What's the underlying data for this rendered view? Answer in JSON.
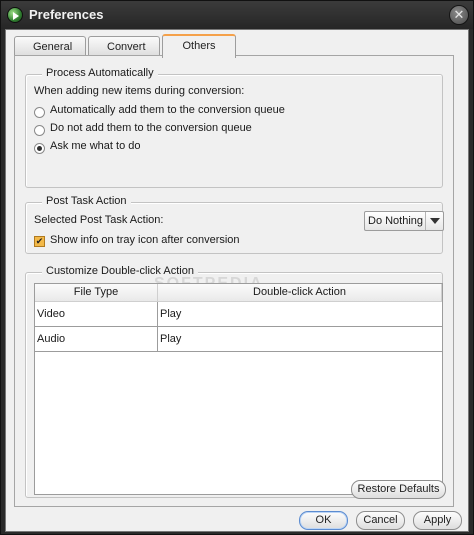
{
  "window": {
    "title": "Preferences",
    "close_glyph": "✕"
  },
  "tabs": [
    {
      "label": "General",
      "active": false
    },
    {
      "label": "Convert",
      "active": false
    },
    {
      "label": "Others",
      "active": true
    }
  ],
  "process_automatically": {
    "title": "Process Automatically",
    "prompt": "When adding new items during conversion:",
    "options": [
      {
        "label": "Automatically add them to the conversion queue",
        "selected": false
      },
      {
        "label": "Do not add them to the conversion queue",
        "selected": false
      },
      {
        "label": "Ask me what to do",
        "selected": true
      }
    ]
  },
  "post_task": {
    "title": "Post Task Action",
    "label": "Selected Post Task Action:",
    "dropdown_value": "Do Nothing",
    "checkbox_label": "Show info on tray icon after conversion",
    "checkbox_checked": true
  },
  "double_click": {
    "title": "Customize Double-click Action",
    "columns": [
      "File Type",
      "Double-click Action"
    ],
    "rows": [
      {
        "file_type": "Video",
        "action": "Play"
      },
      {
        "file_type": "Audio",
        "action": "Play"
      }
    ]
  },
  "buttons": {
    "restore_defaults": "Restore Defaults",
    "ok": "OK",
    "cancel": "Cancel",
    "apply": "Apply"
  },
  "watermark": "SOFTPEDIA",
  "colors": {
    "title_bar": "#2a2a2a",
    "active_tab_accent": "#f5a14a",
    "checkbox_fill": "#f3b948",
    "primary_button_border": "#5b8bd0"
  }
}
